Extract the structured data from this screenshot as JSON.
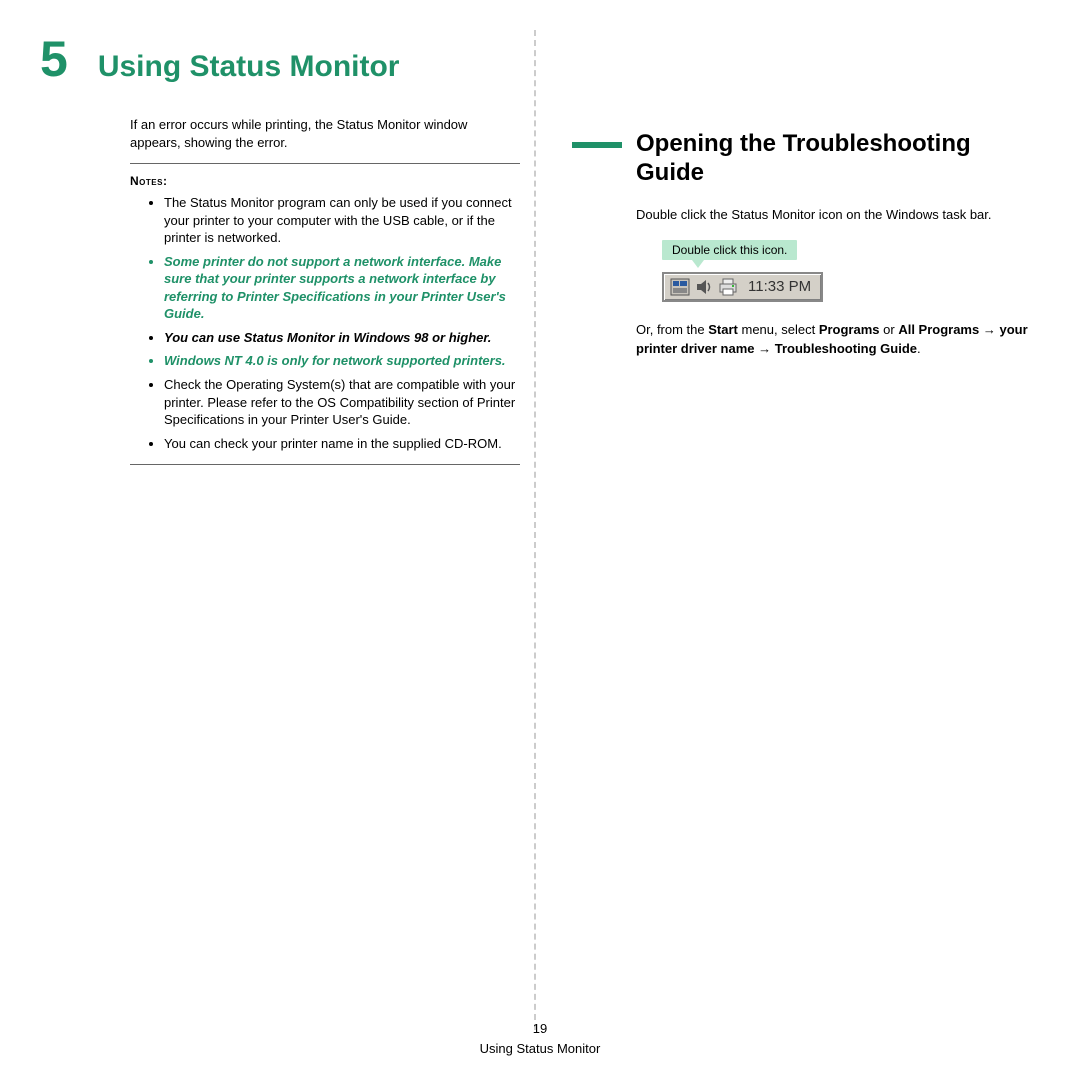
{
  "chapter": {
    "number": "5",
    "title": "Using Status Monitor"
  },
  "intro": "If an error occurs while printing, the Status Monitor window appears, showing the error.",
  "notes_label": "Notes",
  "notes": {
    "n1": "The Status Monitor program can only be used if you connect your printer to your computer with the USB cable, or if the printer is networked.",
    "n2": "Some printer do not support a network interface. Make sure that your printer supports a network interface by referring to Printer Specifications in your Printer User's Guide.",
    "n3": "You can use Status Monitor in Windows 98 or higher.",
    "n4": "Windows NT 4.0 is only for network supported printers.",
    "n5": "Check the Operating System(s) that are compatible with your printer. Please refer to the OS Compatibility section of Printer Specifications in your Printer User's Guide.",
    "n6": "You can check your printer name in the supplied CD-ROM."
  },
  "section_title": "Opening the Troubleshooting Guide",
  "section_body": "Double click the Status Monitor icon on the Windows task bar.",
  "callout": "Double click this icon.",
  "tray_time": "11:33 PM",
  "instr": {
    "p1": "Or, from the ",
    "start": "Start",
    "p2": " menu, select ",
    "programs": "Programs",
    "p3": " or ",
    "allprograms": "All Programs",
    "arrow": " → ",
    "driver": "your printer driver name",
    "guide": "Troubleshooting Guide",
    "period": "."
  },
  "footer": {
    "page": "19",
    "title": "Using Status Monitor"
  }
}
